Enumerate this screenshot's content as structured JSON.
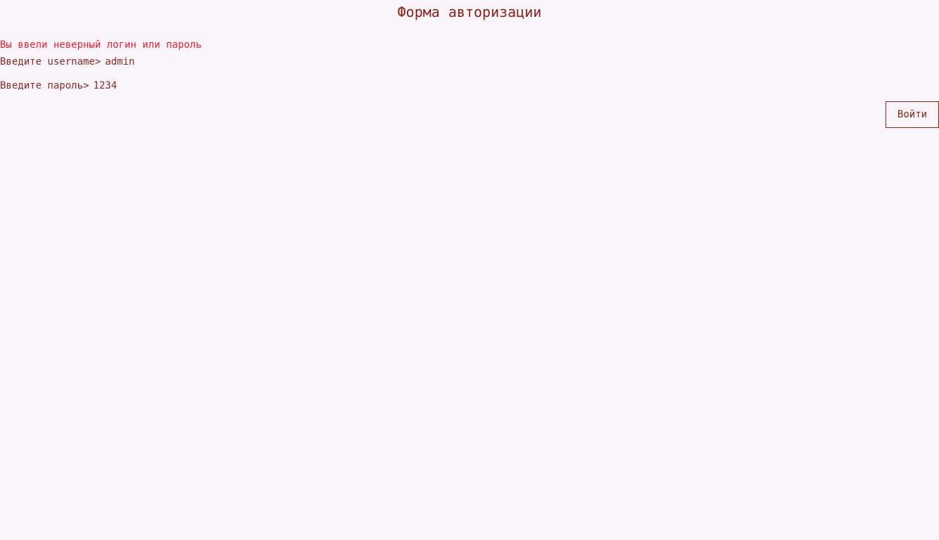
{
  "page": {
    "title": "Форма авторизации"
  },
  "form": {
    "error_message": "Вы ввели неверный логин или пароль",
    "username_prompt": "Введите username>",
    "username_value": "admin",
    "password_prompt": "Введите пароль>",
    "password_value": "1234",
    "submit_label": "Войти"
  },
  "colors": {
    "background": "#f9f4fa",
    "text": "#8a2a24",
    "error": "#e5232e"
  }
}
